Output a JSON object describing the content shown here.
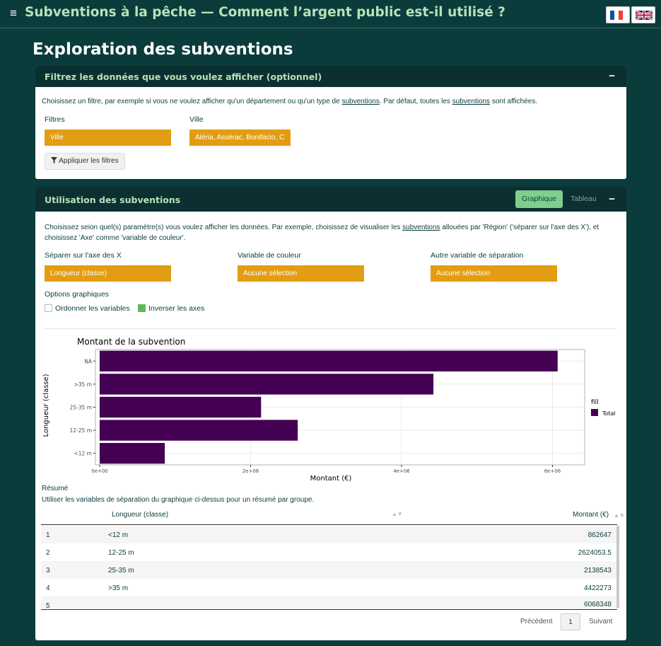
{
  "topbar": {
    "menu_icon": "hamburger-icon",
    "title": "Subventions à la pêche — Comment l’argent public est-il utilisé ?",
    "flags": [
      "flag-fr-icon",
      "flag-uk-icon"
    ]
  },
  "page": {
    "title": "Exploration des subventions"
  },
  "filter_panel": {
    "title": "Filtrez les données que vous voulez afficher (optionnel)",
    "collapse": "−",
    "help_pre": "Choisissez un filtre, par exemple si vous ne voulez afficher qu'un département ou qu'un type de ",
    "help_link1": "subventions",
    "help_mid": ". Par défaut, toutes les ",
    "help_link2": "subventions",
    "help_post": " sont affichées.",
    "filters_label": "Filtres",
    "filters_value": "Ville",
    "city_label": "Ville",
    "city_value": "Aléria, Assérac, Bonifacio, C",
    "apply_button": "Appliquer les filtres",
    "apply_icon": "filter-icon"
  },
  "usage_panel": {
    "title": "Utilisation des subventions",
    "tab_graph": "Graphique",
    "tab_table": "Tableau",
    "collapse": "−",
    "help_pre": "Choisissez seion quel(s) paramètre(s) vous voulez afficher les données. Par exemple, choisissez de visualiser les ",
    "help_link": "subventions",
    "help_post": " allouées par 'Région' ('séparer sur l'axe des X'), et",
    "help_line2": "choisissez 'Axe' comme 'variable de couleur'.",
    "x_label": "Séparer sur l'axe des X",
    "x_value": "Longueur (classe)",
    "color_label": "Variable de couleur",
    "color_value": "Aucune sélection",
    "other_label": "Autre variable de séparation",
    "other_value": "Aucune sélection",
    "options_label": "Options graphiques",
    "opt_order": "Ordonner les variables",
    "opt_order_checked": false,
    "opt_flip": "Inverser les axes",
    "opt_flip_checked": true,
    "summary_title": "Résumé",
    "summary_help": "Utiliser les variables de séparation du graphique ci-dessus pour un résumé par groupe.",
    "col_category": "Longueur (classe)",
    "col_amount": "Montant (€)",
    "rows": [
      {
        "idx": "1",
        "cat": "<12 m",
        "val": "862647"
      },
      {
        "idx": "2",
        "cat": "12-25 m",
        "val": "2624053.5"
      },
      {
        "idx": "3",
        "cat": "25-35 m",
        "val": "2138543"
      },
      {
        "idx": "4",
        "cat": ">35 m",
        "val": "4422273"
      },
      {
        "idx": "5",
        "cat": "",
        "val": "6068348"
      }
    ],
    "prev": "Précédent",
    "page": "1",
    "next": "Suivant"
  },
  "chart_data": {
    "type": "bar",
    "orientation": "horizontal",
    "title": "Montant de la subvention",
    "xlabel": "Montant (€)",
    "ylabel": "Longueur (classe)",
    "categories": [
      "NA",
      ">35 m",
      "25-35 m",
      "12-25 m",
      "<12 m"
    ],
    "series": [
      {
        "name": "Total",
        "values": [
          6068348,
          4422273,
          2138543,
          2624053.5,
          862647
        ]
      }
    ],
    "xlim": [
      0,
      6370000
    ],
    "xticks": [
      0,
      2000000,
      4000000,
      6000000
    ],
    "xtick_labels": [
      "0e+00",
      "2e+06",
      "4e+06",
      "6e+06"
    ],
    "legend_title": "fill",
    "legend_position": "right",
    "bar_color": "#440154",
    "grid": true
  }
}
